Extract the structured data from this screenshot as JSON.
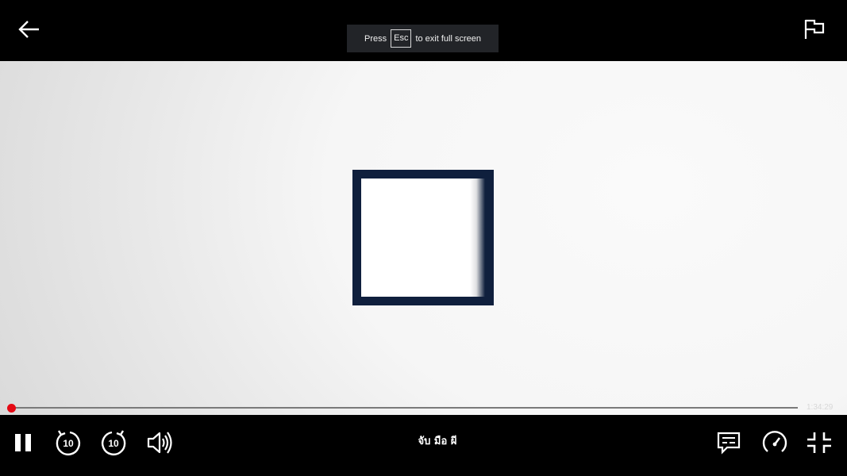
{
  "topbar": {
    "back_icon": "arrow-left-icon",
    "report_icon": "flag-icon"
  },
  "esc_toast": {
    "before": "Press",
    "key": "Esc",
    "after": "to exit full screen"
  },
  "video": {
    "logo_icon": "square-logo"
  },
  "progress": {
    "fraction": 0.0,
    "time_remaining": "1:34:29"
  },
  "controls": {
    "title": "จับ มือ ผี",
    "pause_icon": "pause-icon",
    "rewind_icon": "rewind-10-icon",
    "rewind_seconds": "10",
    "forward_icon": "forward-10-icon",
    "forward_seconds": "10",
    "volume_icon": "volume-icon",
    "subtitles_icon": "subtitles-icon",
    "speed_icon": "playback-speed-icon",
    "fullscreen_icon": "exit-fullscreen-icon"
  },
  "colors": {
    "accent": "#e50914",
    "logo": "#0f1f3d",
    "background": "#000000"
  }
}
